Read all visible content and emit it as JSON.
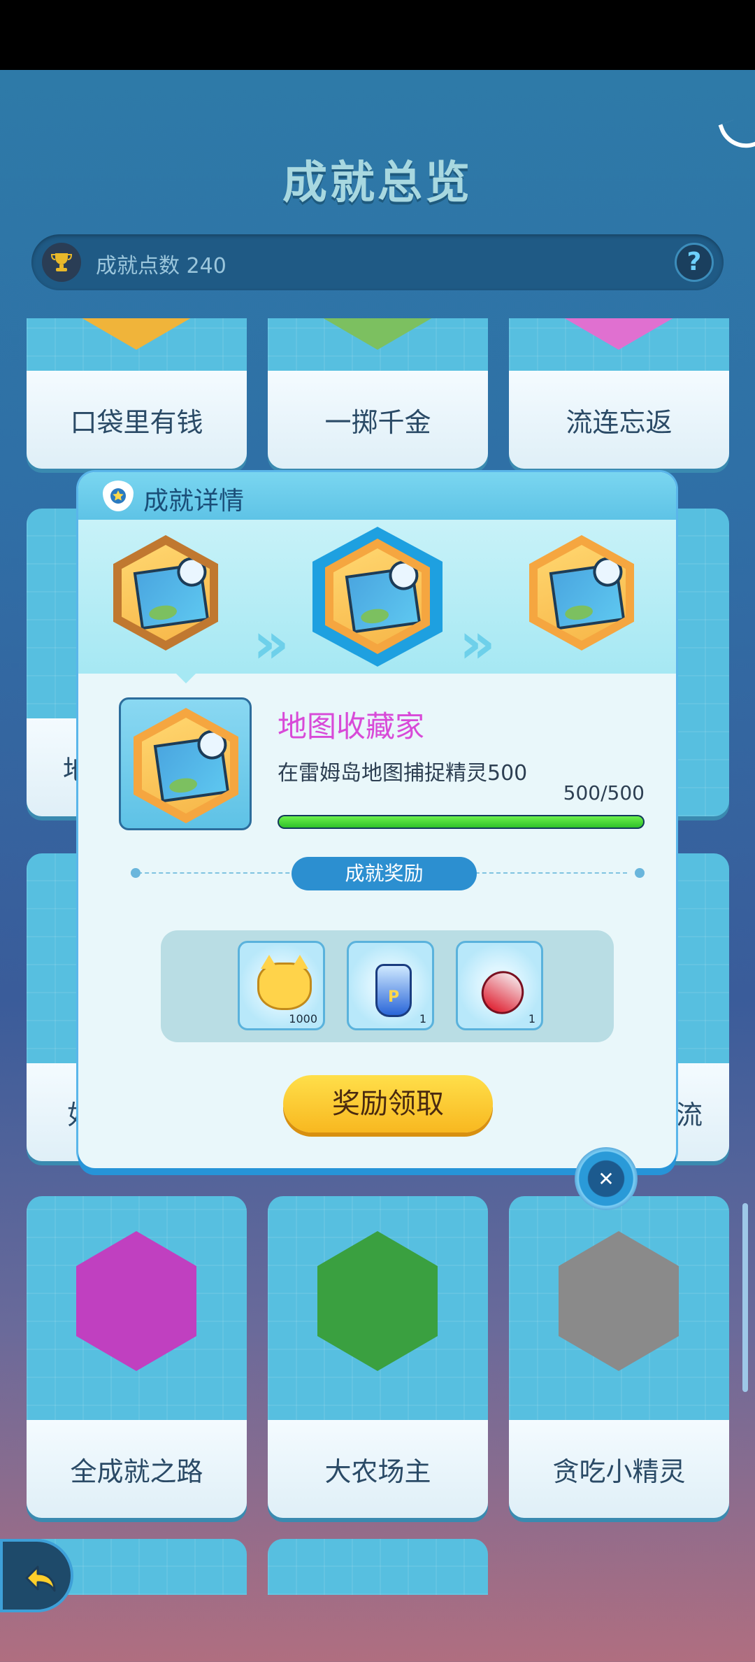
{
  "header": {
    "title": "成就总览"
  },
  "points_bar": {
    "label": "成就点数 240",
    "help_icon": "question-icon",
    "help_glyph": "?"
  },
  "grid": {
    "row1": [
      "口袋里有钱",
      "一掷千金",
      "流连忘返"
    ],
    "row2_visible_fragment_left": "地",
    "row3_visible_fragment_left": "如",
    "row3_visible_fragment_right": "流",
    "row4": [
      "全成就之路",
      "大农场主",
      "贪吃小精灵"
    ]
  },
  "modal": {
    "title": "成就详情",
    "achievement": {
      "name": "地图收藏家",
      "description": "在雷姆岛地图捕捉精灵500",
      "progress_text": "500/500",
      "progress_fraction": 1.0
    },
    "reward_section_label": "成就奖励",
    "rewards": [
      {
        "icon": "cat-coin-icon",
        "count": "1000"
      },
      {
        "icon": "blue-potion-icon",
        "count": "1"
      },
      {
        "icon": "red-potion-icon",
        "count": "1"
      }
    ],
    "claim_button": "奖励领取",
    "colors": {
      "achievement_name": "#d84ad8",
      "progress": "#2fc12a",
      "claim_button": "#f8b820"
    }
  }
}
